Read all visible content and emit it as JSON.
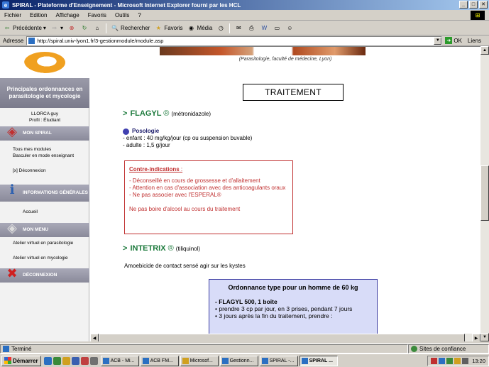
{
  "window": {
    "title": "SPIRAL - Plateforme d'Enseignement - Microsoft Internet Explorer fourni par les HCL"
  },
  "menu": [
    "Fichier",
    "Edition",
    "Affichage",
    "Favoris",
    "Outils",
    "?"
  ],
  "toolbar": {
    "back": "Précédente",
    "search": "Rechercher",
    "favorites": "Favoris",
    "media": "Média"
  },
  "address": {
    "label": "Adresse",
    "url": "http://spiral.univ-lyon1.fr/3-gestionmodule/module.asp",
    "go": "OK",
    "links": "Liens"
  },
  "sidebar": {
    "title": "Principales ordonnances en parasitologie et mycologie",
    "user_name": "LLORCA guy",
    "user_profile": "Profil : Étudiant",
    "sections": [
      {
        "label": "MON SPIRAL",
        "items": [
          "Tous mes modules",
          "Basculer en mode enseignant",
          "[x]  Déconnexion"
        ]
      },
      {
        "label": "INFORMATIONS GÉNÉRALES",
        "items": [
          "Accueil"
        ]
      },
      {
        "label": "MON MENU",
        "items": [
          "Atelier virtuel en parasitologie",
          "Atelier virtuel en mycologie"
        ]
      },
      {
        "label": "DÉCONNEXION",
        "items": []
      }
    ]
  },
  "main": {
    "caption": "(Parasitologie, faculté de médecine, Lyon)",
    "section_title": "TRAITEMENT",
    "drug1": {
      "name": "FLAGYL",
      "reg": "®",
      "generic": "(métronidazole)"
    },
    "posologie": {
      "title": "Posologie",
      "lines": [
        "- enfant : 40 mg/kg/jour (cp ou suspension buvable)",
        "- adulte : 1,5 g/jour"
      ]
    },
    "contraindications": {
      "title": "Contre-indications",
      "colon": " :",
      "lines": [
        "- Déconseillé en cours de grossesse et d'allaitement",
        "- Attention en cas d'association avec des anticoagulants oraux",
        "- Ne pas associer avec l'ESPERAL®"
      ],
      "note": "Ne pas boire d'alcool au cours du traitement"
    },
    "drug2": {
      "name": "INTETRIX",
      "reg": "®",
      "generic": "(tiliquinol)"
    },
    "drug2_desc": "Amoebicide de contact sensé agir sur les kystes",
    "ordonnance": {
      "title": "Ordonnance type pour un homme de 60 kg",
      "drug_line": "- FLAGYL 500, 1 boîte",
      "lines": [
        "•  prendre 3 cp par jour, en 3 prises, pendant 7 jours",
        "•  3 jours après la fin du traitement, prendre :"
      ]
    }
  },
  "status": {
    "left": "Terminé",
    "right": "Sites de confiance"
  },
  "taskbar": {
    "start": "Démarrer",
    "tasks": [
      "ACB - Mi...",
      "ACB FM...",
      "Microsof...",
      "Gestionn...",
      "SPIRAL -...",
      "SPIRAL ..."
    ],
    "clock": "13:20"
  }
}
